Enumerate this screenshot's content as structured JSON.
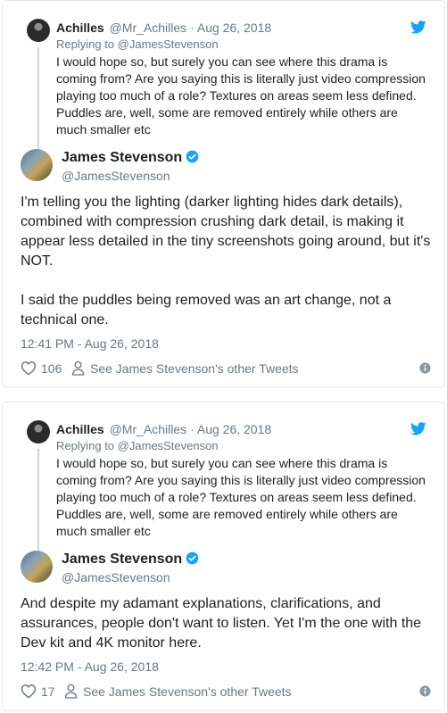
{
  "tweets": [
    {
      "quoted": {
        "name": "Achilles",
        "handle": "@Mr_Achilles",
        "sep": "·",
        "date": "Aug 26, 2018",
        "replying_to": "Replying to @JamesStevenson",
        "text": "I would hope so, but surely you can see where this drama is coming from? Are you saying this is literally just video compression playing too much of a role? Textures on areas seem less defined. Puddles are, well, some are removed entirely while others are much smaller etc"
      },
      "author": {
        "name": "James Stevenson",
        "handle": "@JamesStevenson"
      },
      "paragraphs": [
        "I'm telling you the lighting (darker lighting hides dark details), combined with compression crushing dark detail, is making it appear less detailed in the tiny screenshots going around, but it's NOT.",
        "I said the puddles being removed was an art change, not a technical one."
      ],
      "timestamp": "12:41 PM - Aug 26, 2018",
      "likes": "106",
      "other_tweets_label": "See James Stevenson's other Tweets"
    },
    {
      "quoted": {
        "name": "Achilles",
        "handle": "@Mr_Achilles",
        "sep": "·",
        "date": "Aug 26, 2018",
        "replying_to": "Replying to @JamesStevenson",
        "text": "I would hope so, but surely you can see where this drama is coming from? Are you saying this is literally just video compression playing too much of a role? Textures on areas seem less defined. Puddles are, well, some are removed entirely while others are much smaller etc"
      },
      "author": {
        "name": "James Stevenson",
        "handle": "@JamesStevenson"
      },
      "paragraphs": [
        "And despite my adamant explanations, clarifications, and assurances, people don't want to listen. Yet I'm the one with the Dev kit and 4K monitor here."
      ],
      "timestamp": "12:42 PM - Aug 26, 2018",
      "likes": "17",
      "other_tweets_label": "See James Stevenson's other Tweets"
    }
  ],
  "icons": {
    "bird": "twitter-bird-icon",
    "heart": "heart-icon",
    "person": "person-icon",
    "info": "info-icon",
    "verified": "verified-badge-icon"
  },
  "colors": {
    "twitter_blue": "#1da1f2",
    "text": "#1c2022",
    "muted": "#697882",
    "border": "#e1e8ed"
  }
}
